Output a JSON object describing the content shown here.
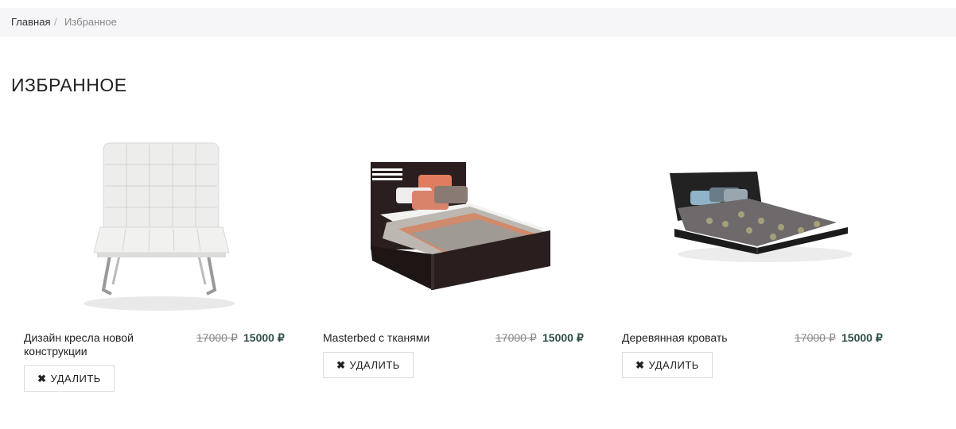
{
  "breadcrumb": {
    "home": "Главная",
    "separator": "/",
    "current": "Избранное"
  },
  "page_title": "ИЗБРАННОЕ",
  "products": [
    {
      "name": "Дизайн кресла новой конструкции",
      "old_price": "17000 ₽",
      "new_price": "15000 ₽",
      "remove_label": "УДАЛИТЬ",
      "icon": "close-icon"
    },
    {
      "name": "Masterbed с тканями",
      "old_price": "17000 ₽",
      "new_price": "15000 ₽",
      "remove_label": "УДАЛИТЬ",
      "icon": "close-icon"
    },
    {
      "name": "Деревянная кровать",
      "old_price": "17000 ₽",
      "new_price": "15000 ₽",
      "remove_label": "УДАЛИТЬ",
      "icon": "close-icon"
    }
  ],
  "colors": {
    "new_price": "#2f4f4a",
    "old_price": "#888888",
    "breadcrumb_bg": "#f6f6f8"
  }
}
